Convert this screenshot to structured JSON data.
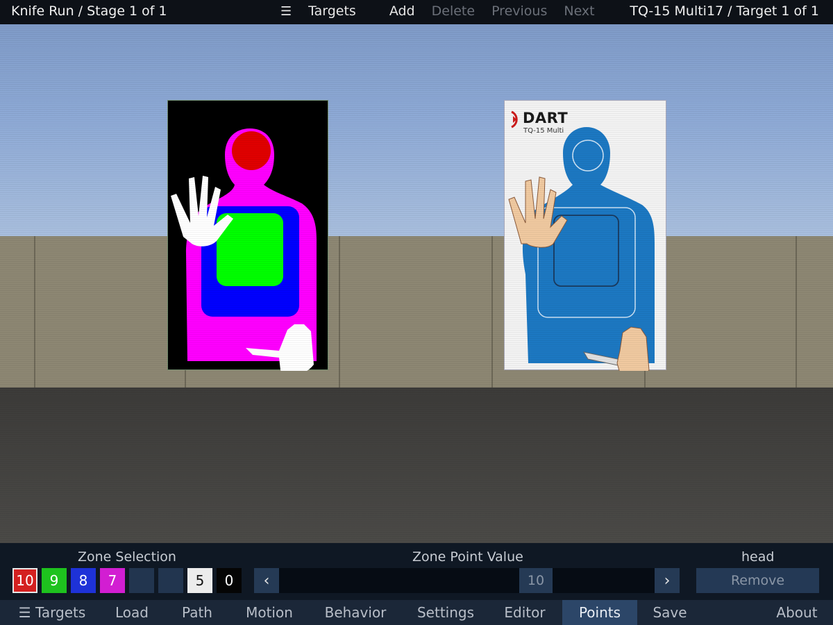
{
  "topbar": {
    "stage_title": "Knife Run / Stage 1 of 1",
    "targets_label": "Targets",
    "add_label": "Add",
    "delete_label": "Delete",
    "previous_label": "Previous",
    "next_label": "Next",
    "target_title": "TQ-15 Multi17 / Target 1 of 1"
  },
  "targets": {
    "right_brand": "DART",
    "right_model": "TQ-15 Multi"
  },
  "panel": {
    "zone_selection_label": "Zone Selection",
    "zone_point_value_label": "Zone Point Value",
    "zone_name": "head",
    "zones": [
      {
        "label": "10",
        "color": "#d42020"
      },
      {
        "label": "9",
        "color": "#1ec21e"
      },
      {
        "label": "8",
        "color": "#1e32d8"
      },
      {
        "label": "7",
        "color": "#d21ed2"
      },
      {
        "label": "",
        "color": "#22354f"
      },
      {
        "label": "",
        "color": "#22354f"
      },
      {
        "label": "5",
        "color": "#ececec"
      },
      {
        "label": "0",
        "color": "#050505"
      }
    ],
    "point_value": "10",
    "remove_label": "Remove"
  },
  "nav": {
    "items": [
      "Targets",
      "Load",
      "Path",
      "Motion",
      "Behavior",
      "Settings",
      "Editor",
      "Points",
      "Save",
      "About"
    ],
    "active": "Points"
  },
  "colors": {
    "accent": "#2c4668",
    "head_zone": "#e00000",
    "neck_body_zone": "#ff00ff",
    "center_zone": "#0000ff",
    "inner_zone": "#00ff00",
    "tq15_blue": "#1c78c2"
  }
}
